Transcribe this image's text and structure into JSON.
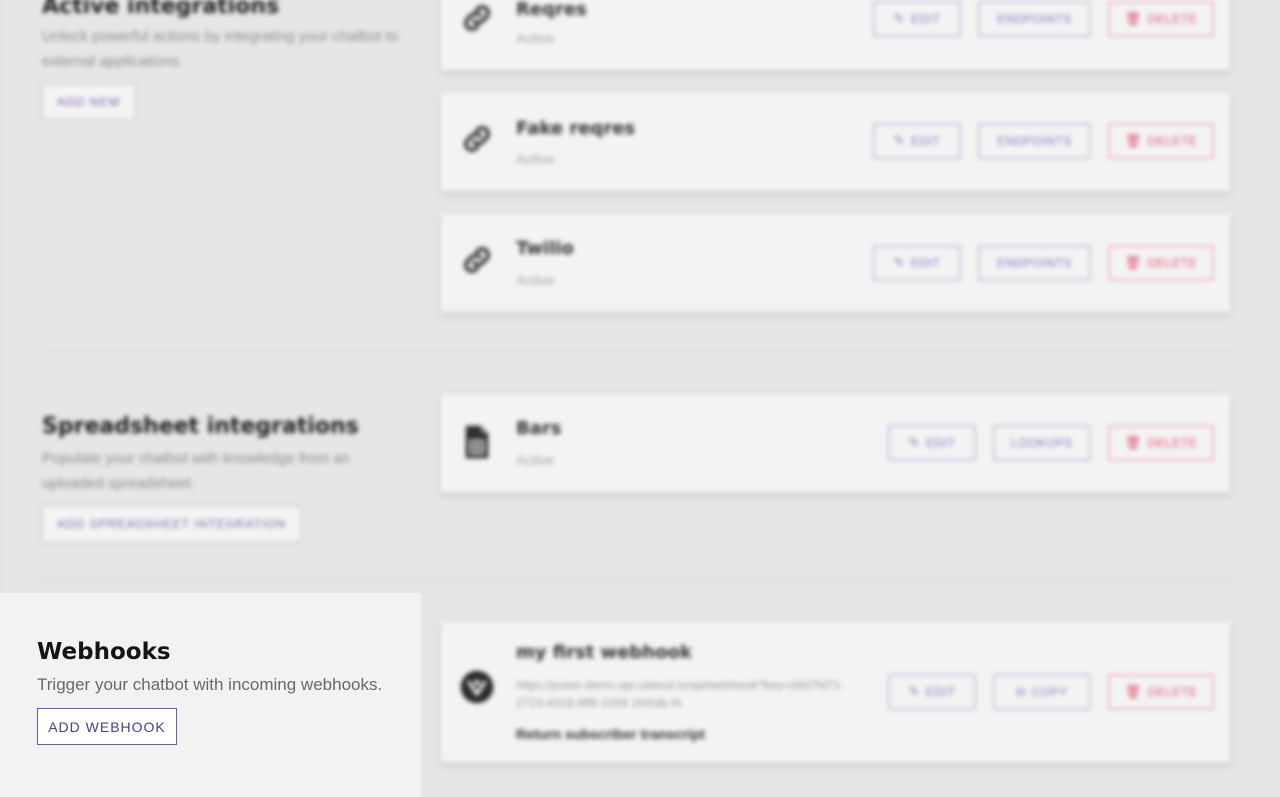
{
  "active_integrations": {
    "title": "Active integrations",
    "description": "Unlock powerful actions by integrating your chatbot to external applications.",
    "add_label": "ADD NEW",
    "items": [
      {
        "name": "Reqres",
        "status": "Active",
        "icon": "link-icon",
        "edit_label": "EDIT",
        "secondary_label": "ENDPOINTS",
        "delete_label": "DELETE"
      },
      {
        "name": "Fake reqres",
        "status": "Active",
        "icon": "link-icon",
        "edit_label": "EDIT",
        "secondary_label": "ENDPOINTS",
        "delete_label": "DELETE"
      },
      {
        "name": "Twilio",
        "status": "Active",
        "icon": "link-icon",
        "edit_label": "EDIT",
        "secondary_label": "ENDPOINTS",
        "delete_label": "DELETE"
      }
    ]
  },
  "spreadsheet_integrations": {
    "title": "Spreadsheet integrations",
    "description": "Populate your chatbot with knowledge from an uploaded spreadsheet.",
    "add_label": "ADD SPREADSHEET INTEGRATION",
    "items": [
      {
        "name": "Bars",
        "status": "Active",
        "icon": "spreadsheet-file-icon",
        "edit_label": "EDIT",
        "secondary_label": "LOOKUPS",
        "delete_label": "DELETE"
      }
    ]
  },
  "webhooks": {
    "title": "Webhooks",
    "description": "Trigger your chatbot with incoming webhooks.",
    "add_label": "ADD WEBHOOK",
    "items": [
      {
        "name": "my first webhook",
        "url": "https://pulse-demo-api.ubiend.io/api/webhook?key=d4d7fd71-2723-4318-9ff8-1008 1fe5db f4",
        "note": "Return subscriber transcript",
        "icon": "webhook-icon",
        "edit_label": "EDIT",
        "copy_label": "COPY",
        "delete_label": "DELETE"
      }
    ]
  },
  "colors": {
    "accent": "#4d3c87",
    "button_purple": "#8a70c0",
    "delete_red": "#df4f70",
    "page_bg": "#e6e6e6",
    "panel_bg": "#f2f2f2"
  }
}
